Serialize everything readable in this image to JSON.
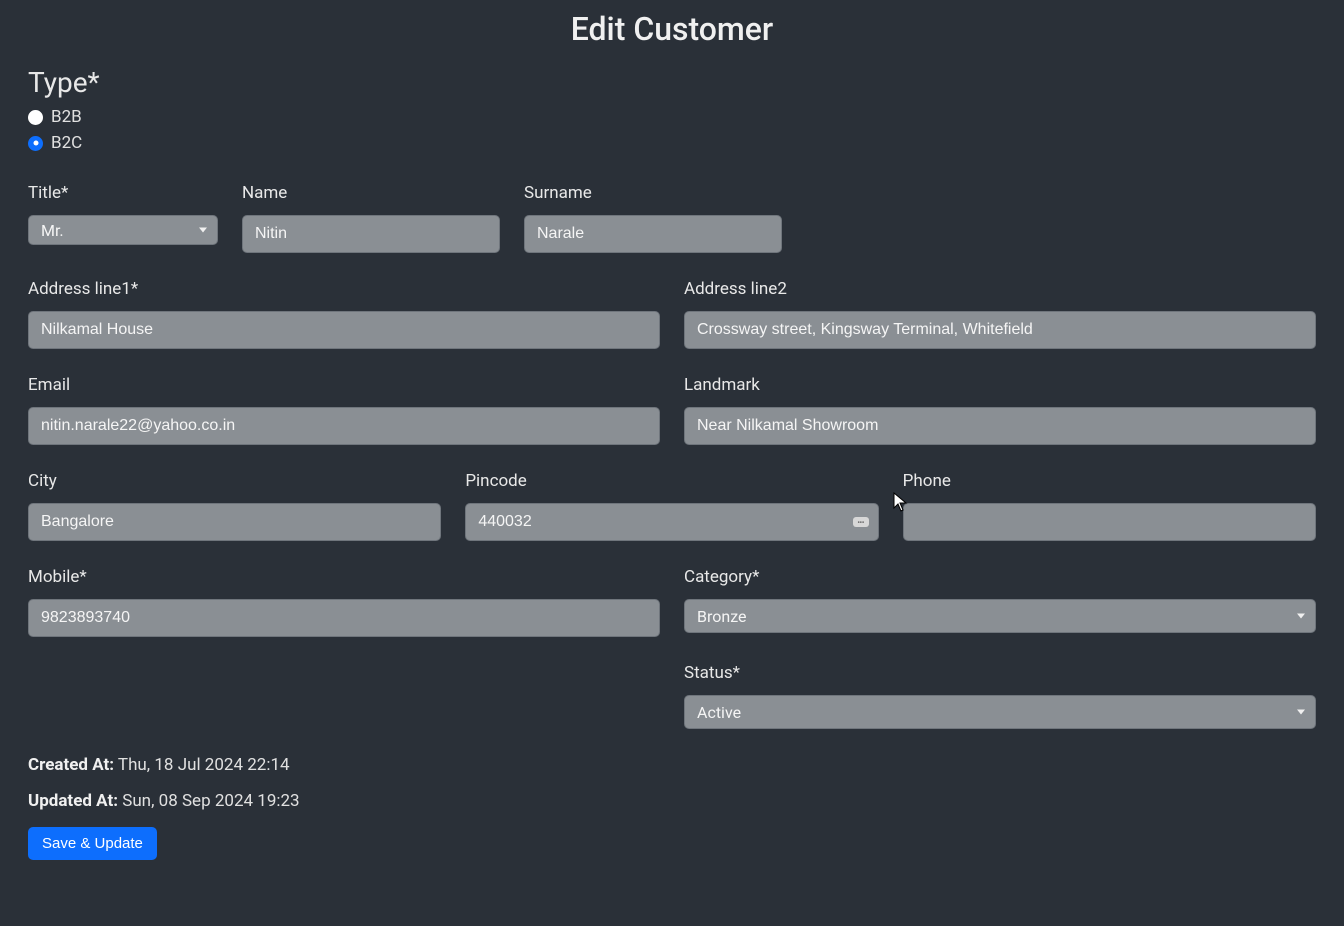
{
  "page": {
    "title": "Edit Customer"
  },
  "type": {
    "label": "Type*",
    "options": {
      "b2b": "B2B",
      "b2c": "B2C"
    },
    "selected": "b2c"
  },
  "fields": {
    "title": {
      "label": "Title*",
      "value": "Mr."
    },
    "name": {
      "label": "Name",
      "value": "Nitin"
    },
    "surname": {
      "label": "Surname",
      "value": "Narale"
    },
    "address1": {
      "label": "Address line1*",
      "value": "Nilkamal House"
    },
    "address2": {
      "label": "Address line2",
      "value": "Crossway street, Kingsway Terminal, Whitefield"
    },
    "email": {
      "label": "Email",
      "value": "nitin.narale22@yahoo.co.in"
    },
    "landmark": {
      "label": "Landmark",
      "value": "Near Nilkamal Showroom"
    },
    "city": {
      "label": "City",
      "value": "Bangalore"
    },
    "pincode": {
      "label": "Pincode",
      "value": "440032"
    },
    "phone": {
      "label": "Phone",
      "value": ""
    },
    "mobile": {
      "label": "Mobile*",
      "value": "9823893740"
    },
    "category": {
      "label": "Category*",
      "value": "Bronze"
    },
    "status": {
      "label": "Status*",
      "value": "Active"
    }
  },
  "meta": {
    "created_label": "Created At:",
    "created_value": "Thu, 18 Jul 2024 22:14",
    "updated_label": "Updated At:",
    "updated_value": "Sun, 08 Sep 2024 19:23"
  },
  "actions": {
    "save": "Save & Update"
  }
}
